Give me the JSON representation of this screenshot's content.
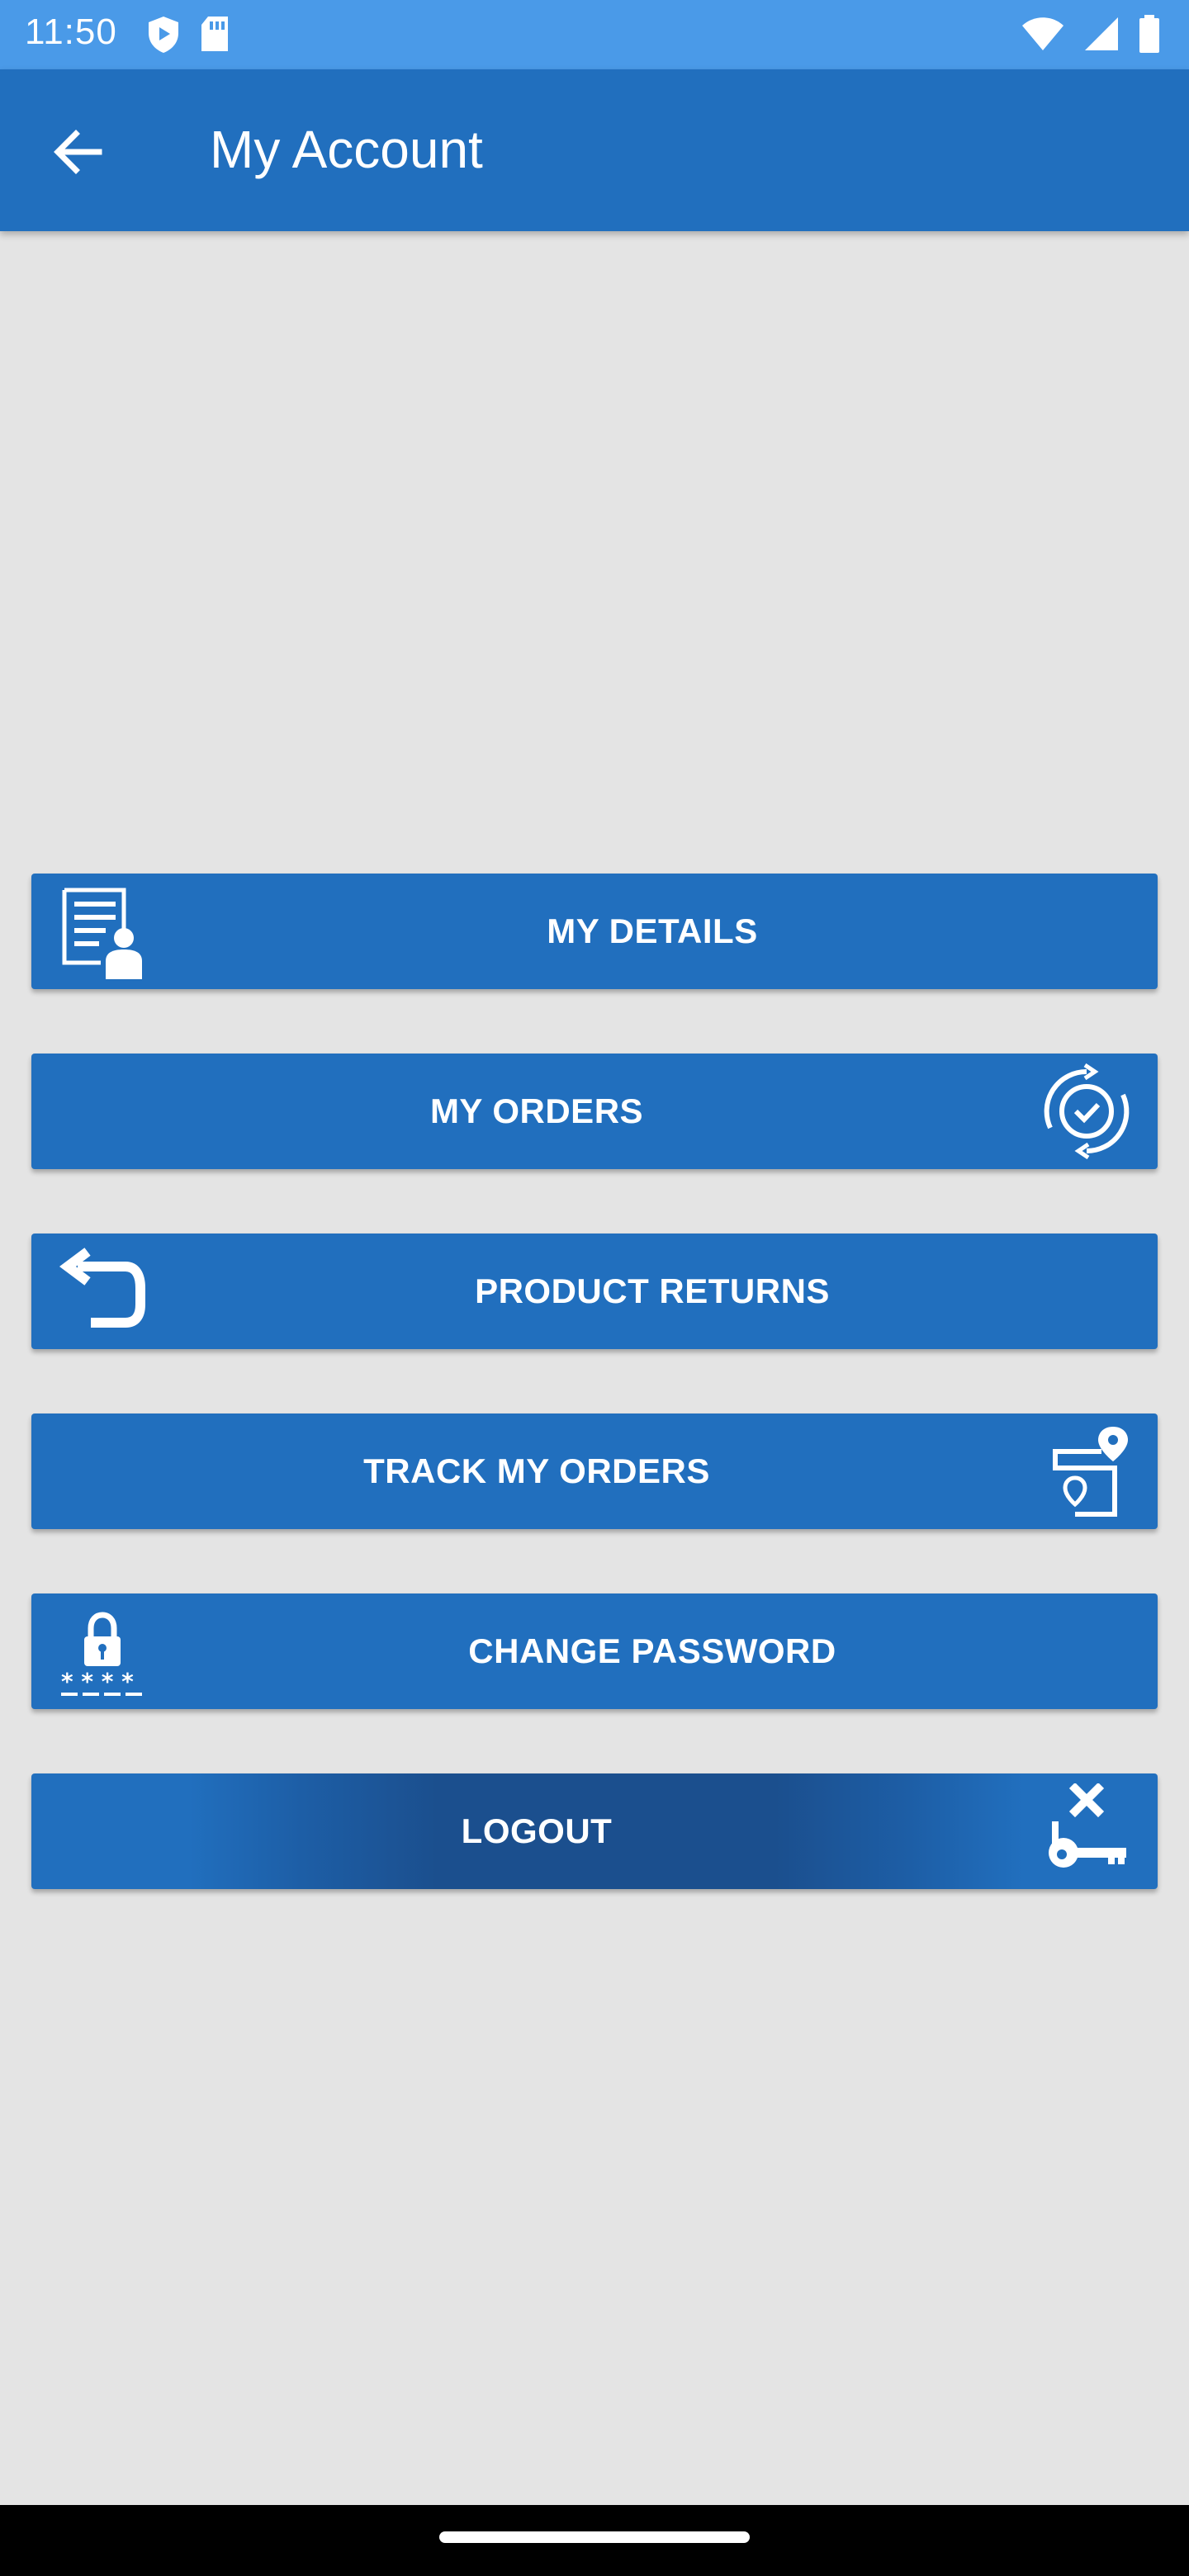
{
  "status_bar": {
    "time": "11:50",
    "left_icons": [
      "play-protect-icon",
      "sd-card-icon"
    ],
    "right_icons": [
      "wifi-icon",
      "signal-icon",
      "battery-icon"
    ]
  },
  "app_bar": {
    "title": "My Account",
    "back_icon": "arrow-back-icon"
  },
  "menu": {
    "my_details": "MY DETAILS",
    "my_orders": "MY ORDERS",
    "product_returns": "PRODUCT RETURNS",
    "track_my_orders": "TRACK MY ORDERS",
    "change_password": "CHANGE PASSWORD",
    "logout": "LOGOUT"
  },
  "colors": {
    "status_bar": "#4a9ae8",
    "primary": "#216fbe",
    "background": "#e4e4e4",
    "nav_bar": "#000000"
  }
}
